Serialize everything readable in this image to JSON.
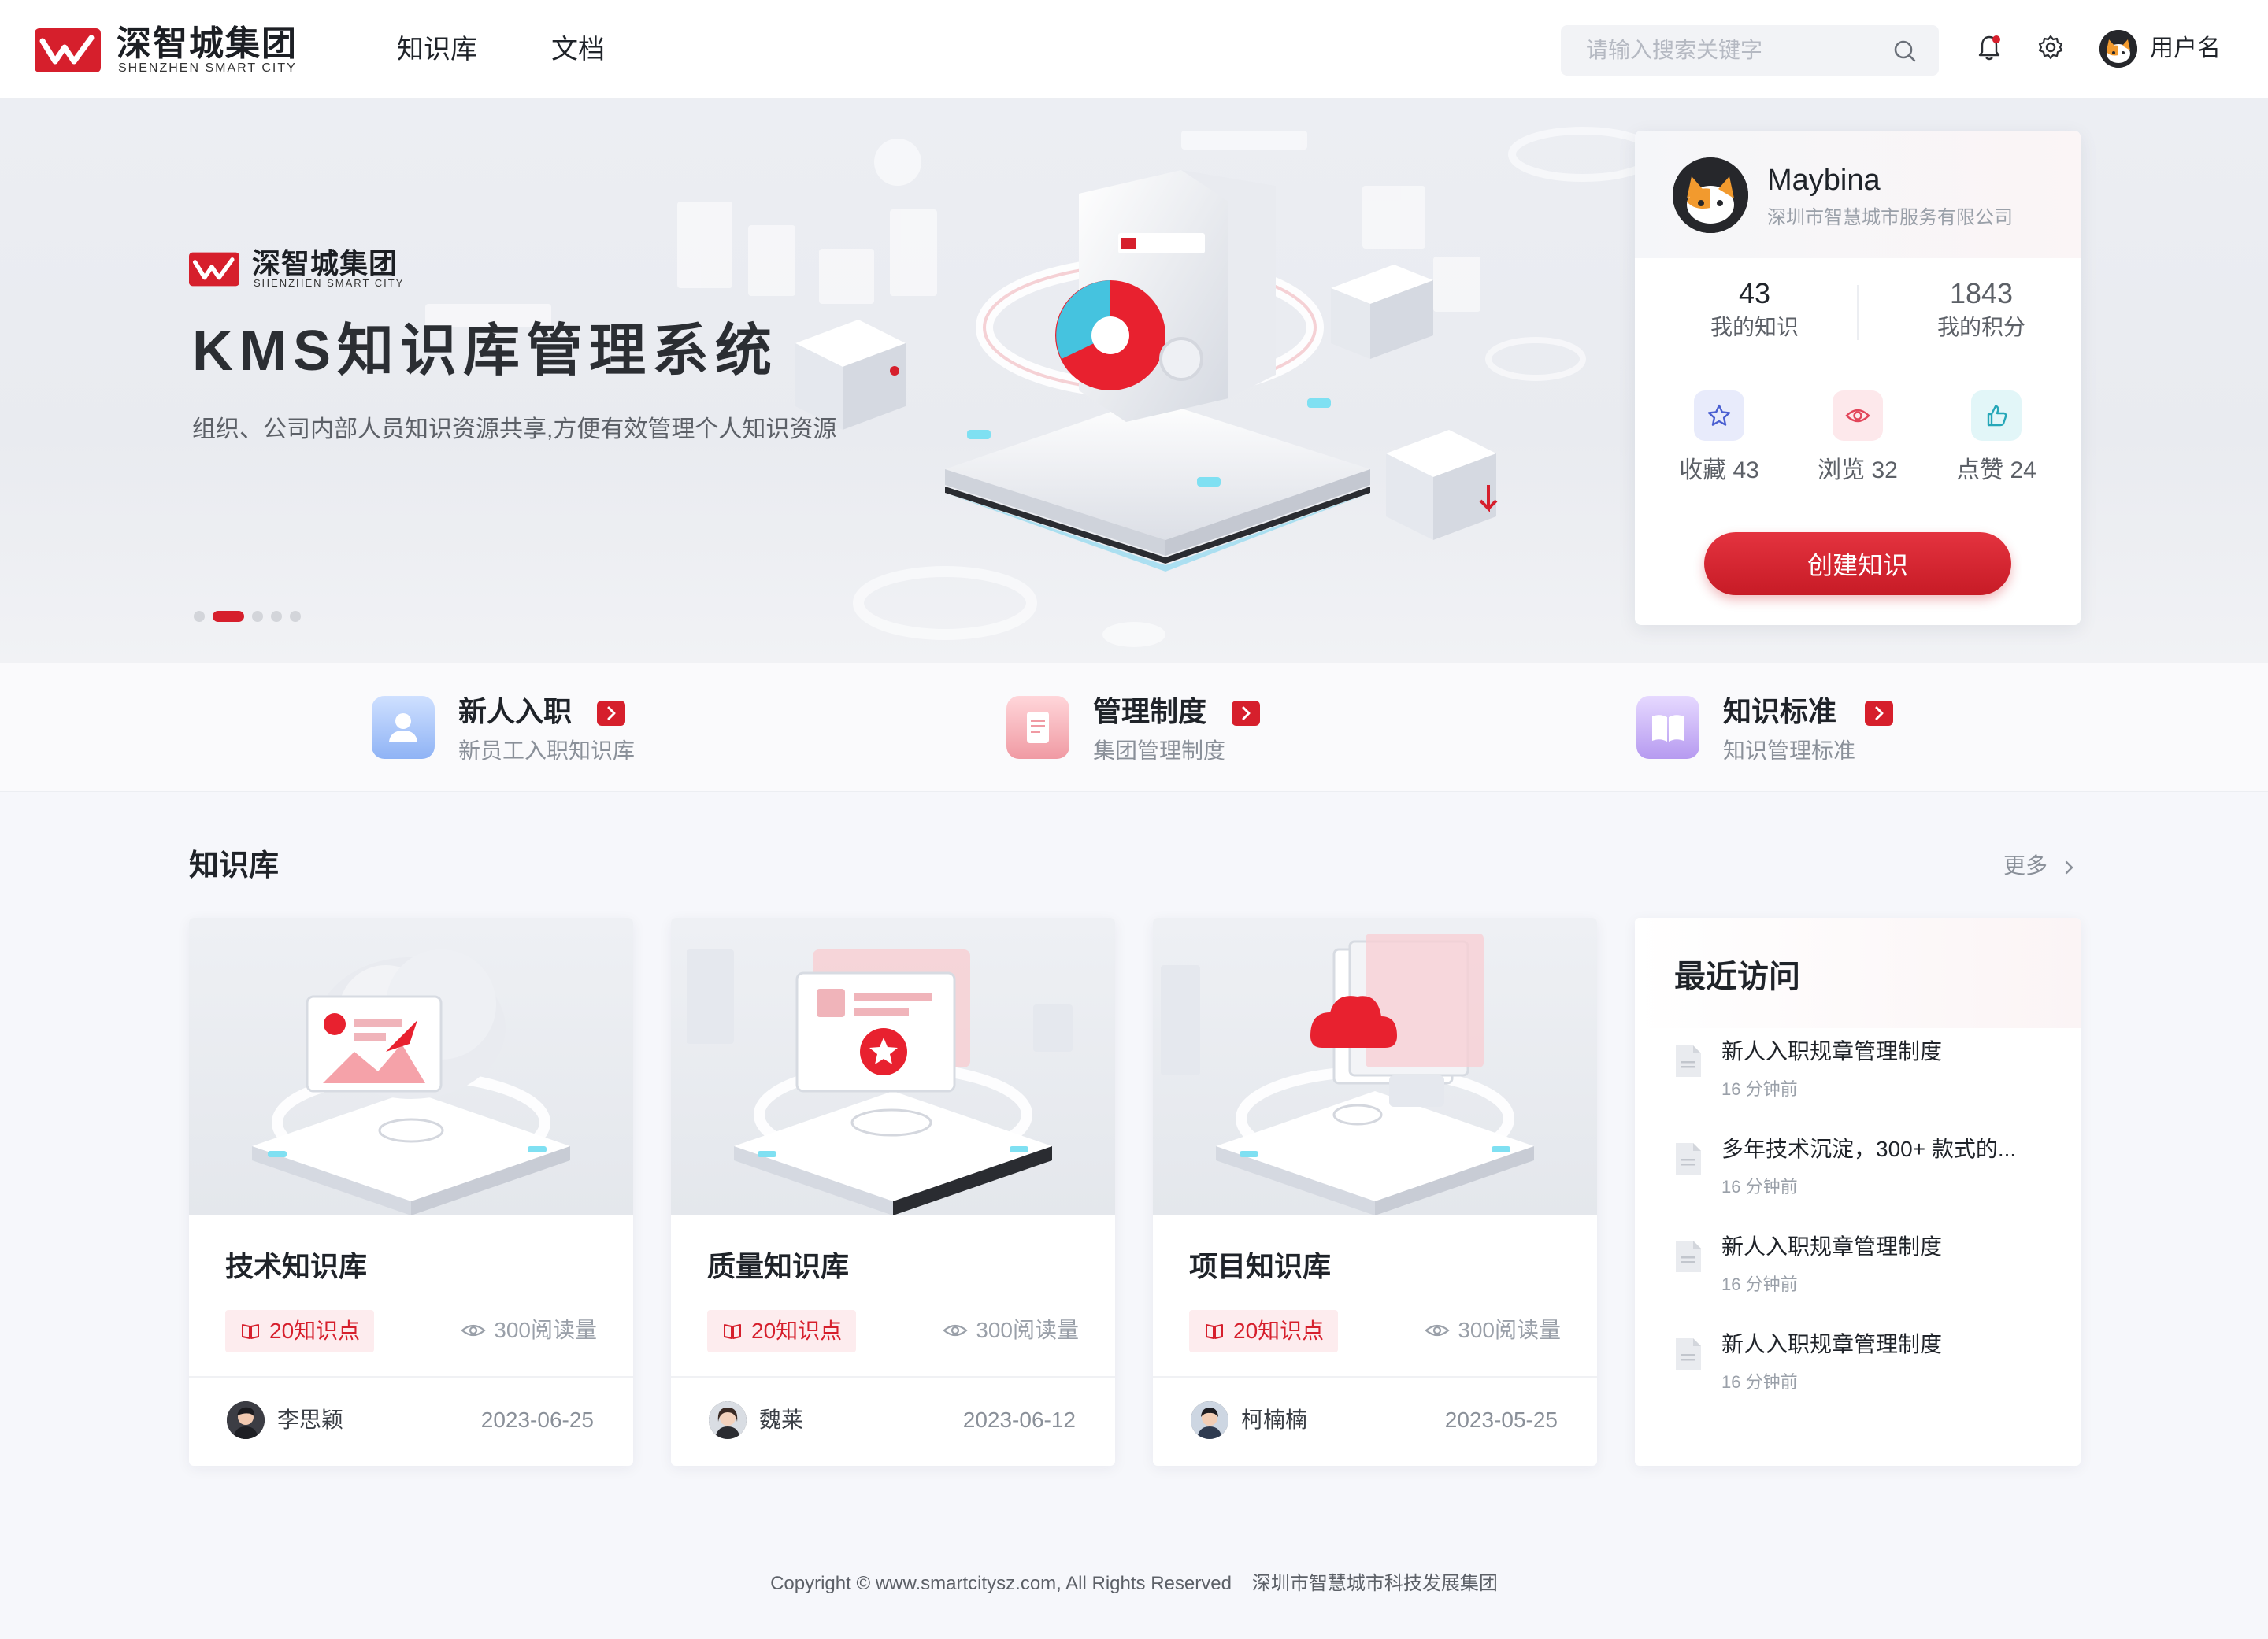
{
  "header": {
    "logo_cn": "深智城集团",
    "logo_en": "SHENZHEN SMART CITY",
    "nav": [
      "知识库",
      "文档"
    ],
    "search_placeholder": "请输入搜索关键字",
    "user_name": "用户名",
    "icons": [
      "search-icon",
      "bell-icon",
      "gear-icon"
    ],
    "notification_dot_color": "#d61f2c"
  },
  "banner": {
    "logo_cn": "深智城集团",
    "logo_en": "SHENZHEN SMART CITY",
    "title": "KMS知识库管理系统",
    "subtitle": "组织、公司内部人员知识资源共享,方便有效管理个人知识资源",
    "carousel": {
      "count": 5,
      "active_index": 1
    }
  },
  "profile": {
    "name": "Maybina",
    "company": "深圳市智慧城市服务有限公司",
    "stats": [
      {
        "value": "43",
        "label": "我的知识"
      },
      {
        "value": "1843",
        "label": "我的积分"
      }
    ],
    "actions": [
      {
        "label": "收藏 43",
        "icon": "star-icon",
        "color": "#4a5fd1"
      },
      {
        "label": "浏览 32",
        "icon": "eye-icon",
        "color": "#e2455a"
      },
      {
        "label": "点赞 24",
        "icon": "thumbs-up-icon",
        "color": "#25a7b8"
      }
    ],
    "create_button": "创建知识"
  },
  "quick_links": [
    {
      "title": "新人入职",
      "subtitle": "新员工入职知识库",
      "icon": "user-icon",
      "color": "#6d9cf2"
    },
    {
      "title": "管理制度",
      "subtitle": "集团管理制度",
      "icon": "document-icon",
      "color": "#ef8b93"
    },
    {
      "title": "知识标准",
      "subtitle": "知识管理标准",
      "icon": "book-icon",
      "color": "#a98be8"
    }
  ],
  "knowledge": {
    "section_title": "知识库",
    "more_label": "更多",
    "cards": [
      {
        "title": "技术知识库",
        "points": "20知识点",
        "reads": "300阅读量",
        "author": "李思颖",
        "date": "2023-06-25"
      },
      {
        "title": "质量知识库",
        "points": "20知识点",
        "reads": "300阅读量",
        "author": "魏莱",
        "date": "2023-06-12"
      },
      {
        "title": "项目知识库",
        "points": "20知识点",
        "reads": "300阅读量",
        "author": "柯楠楠",
        "date": "2023-05-25"
      }
    ]
  },
  "recent": {
    "title": "最近访问",
    "items": [
      {
        "title": "新人入职规章管理制度",
        "time": "16 分钟前"
      },
      {
        "title": "多年技术沉淀，300+ 款式的...",
        "time": "16 分钟前"
      },
      {
        "title": "新人入职规章管理制度",
        "time": "16 分钟前"
      },
      {
        "title": "新人入职规章管理制度",
        "time": "16 分钟前"
      }
    ]
  },
  "footer": {
    "copyright": "Copyright © www.smartcitysz.com, All Rights Reserved",
    "company": "深圳市智慧城市科技发展集团"
  },
  "colors": {
    "brand_red": "#d61f2c",
    "page_bg": "#f6f7fb"
  }
}
